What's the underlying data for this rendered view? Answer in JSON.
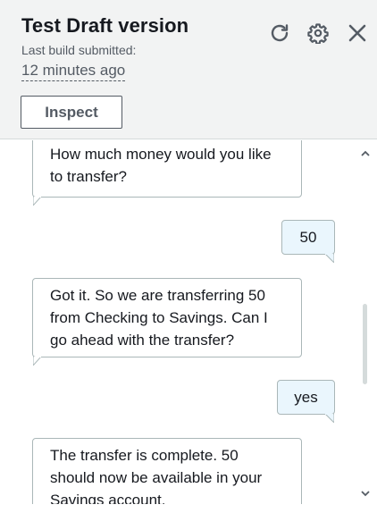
{
  "header": {
    "title": "Test Draft version",
    "build_label": "Last build submitted:",
    "build_time": "12 minutes ago",
    "inspect_label": "Inspect",
    "icons": {
      "refresh": "refresh-icon",
      "settings": "gear-icon",
      "close": "close-icon"
    }
  },
  "conversation": {
    "messages": [
      {
        "role": "bot",
        "lines": [
          "How much money would you like",
          "to transfer?"
        ]
      },
      {
        "role": "user",
        "text": "50"
      },
      {
        "role": "bot",
        "lines": [
          "Got it. So we are transferring 50",
          "from Checking to Savings. Can I",
          "go ahead with the transfer?"
        ]
      },
      {
        "role": "user",
        "text": "yes"
      },
      {
        "role": "bot",
        "lines": [
          "The transfer is complete. 50",
          "should now be available in your",
          "Savings account."
        ]
      }
    ]
  },
  "scrollbar": {
    "up_icon": "chevron-up-icon",
    "down_icon": "chevron-down-icon",
    "position": 0.6
  },
  "colors": {
    "header_bg": "#f2f3f3",
    "user_bubble_bg": "#eaf6fd",
    "bubble_border": "#aab7b8",
    "text": "#16191f",
    "secondary_text": "#545b64"
  }
}
